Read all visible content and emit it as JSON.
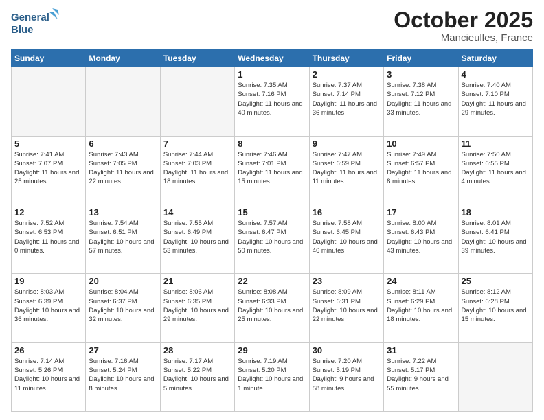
{
  "header": {
    "logo_line1": "General",
    "logo_line2": "Blue",
    "month": "October 2025",
    "location": "Mancieulles, France"
  },
  "weekdays": [
    "Sunday",
    "Monday",
    "Tuesday",
    "Wednesday",
    "Thursday",
    "Friday",
    "Saturday"
  ],
  "weeks": [
    [
      {
        "day": "",
        "info": ""
      },
      {
        "day": "",
        "info": ""
      },
      {
        "day": "",
        "info": ""
      },
      {
        "day": "1",
        "info": "Sunrise: 7:35 AM\nSunset: 7:16 PM\nDaylight: 11 hours\nand 40 minutes."
      },
      {
        "day": "2",
        "info": "Sunrise: 7:37 AM\nSunset: 7:14 PM\nDaylight: 11 hours\nand 36 minutes."
      },
      {
        "day": "3",
        "info": "Sunrise: 7:38 AM\nSunset: 7:12 PM\nDaylight: 11 hours\nand 33 minutes."
      },
      {
        "day": "4",
        "info": "Sunrise: 7:40 AM\nSunset: 7:10 PM\nDaylight: 11 hours\nand 29 minutes."
      }
    ],
    [
      {
        "day": "5",
        "info": "Sunrise: 7:41 AM\nSunset: 7:07 PM\nDaylight: 11 hours\nand 25 minutes."
      },
      {
        "day": "6",
        "info": "Sunrise: 7:43 AM\nSunset: 7:05 PM\nDaylight: 11 hours\nand 22 minutes."
      },
      {
        "day": "7",
        "info": "Sunrise: 7:44 AM\nSunset: 7:03 PM\nDaylight: 11 hours\nand 18 minutes."
      },
      {
        "day": "8",
        "info": "Sunrise: 7:46 AM\nSunset: 7:01 PM\nDaylight: 11 hours\nand 15 minutes."
      },
      {
        "day": "9",
        "info": "Sunrise: 7:47 AM\nSunset: 6:59 PM\nDaylight: 11 hours\nand 11 minutes."
      },
      {
        "day": "10",
        "info": "Sunrise: 7:49 AM\nSunset: 6:57 PM\nDaylight: 11 hours\nand 8 minutes."
      },
      {
        "day": "11",
        "info": "Sunrise: 7:50 AM\nSunset: 6:55 PM\nDaylight: 11 hours\nand 4 minutes."
      }
    ],
    [
      {
        "day": "12",
        "info": "Sunrise: 7:52 AM\nSunset: 6:53 PM\nDaylight: 11 hours\nand 0 minutes."
      },
      {
        "day": "13",
        "info": "Sunrise: 7:54 AM\nSunset: 6:51 PM\nDaylight: 10 hours\nand 57 minutes."
      },
      {
        "day": "14",
        "info": "Sunrise: 7:55 AM\nSunset: 6:49 PM\nDaylight: 10 hours\nand 53 minutes."
      },
      {
        "day": "15",
        "info": "Sunrise: 7:57 AM\nSunset: 6:47 PM\nDaylight: 10 hours\nand 50 minutes."
      },
      {
        "day": "16",
        "info": "Sunrise: 7:58 AM\nSunset: 6:45 PM\nDaylight: 10 hours\nand 46 minutes."
      },
      {
        "day": "17",
        "info": "Sunrise: 8:00 AM\nSunset: 6:43 PM\nDaylight: 10 hours\nand 43 minutes."
      },
      {
        "day": "18",
        "info": "Sunrise: 8:01 AM\nSunset: 6:41 PM\nDaylight: 10 hours\nand 39 minutes."
      }
    ],
    [
      {
        "day": "19",
        "info": "Sunrise: 8:03 AM\nSunset: 6:39 PM\nDaylight: 10 hours\nand 36 minutes."
      },
      {
        "day": "20",
        "info": "Sunrise: 8:04 AM\nSunset: 6:37 PM\nDaylight: 10 hours\nand 32 minutes."
      },
      {
        "day": "21",
        "info": "Sunrise: 8:06 AM\nSunset: 6:35 PM\nDaylight: 10 hours\nand 29 minutes."
      },
      {
        "day": "22",
        "info": "Sunrise: 8:08 AM\nSunset: 6:33 PM\nDaylight: 10 hours\nand 25 minutes."
      },
      {
        "day": "23",
        "info": "Sunrise: 8:09 AM\nSunset: 6:31 PM\nDaylight: 10 hours\nand 22 minutes."
      },
      {
        "day": "24",
        "info": "Sunrise: 8:11 AM\nSunset: 6:29 PM\nDaylight: 10 hours\nand 18 minutes."
      },
      {
        "day": "25",
        "info": "Sunrise: 8:12 AM\nSunset: 6:28 PM\nDaylight: 10 hours\nand 15 minutes."
      }
    ],
    [
      {
        "day": "26",
        "info": "Sunrise: 7:14 AM\nSunset: 5:26 PM\nDaylight: 10 hours\nand 11 minutes."
      },
      {
        "day": "27",
        "info": "Sunrise: 7:16 AM\nSunset: 5:24 PM\nDaylight: 10 hours\nand 8 minutes."
      },
      {
        "day": "28",
        "info": "Sunrise: 7:17 AM\nSunset: 5:22 PM\nDaylight: 10 hours\nand 5 minutes."
      },
      {
        "day": "29",
        "info": "Sunrise: 7:19 AM\nSunset: 5:20 PM\nDaylight: 10 hours\nand 1 minute."
      },
      {
        "day": "30",
        "info": "Sunrise: 7:20 AM\nSunset: 5:19 PM\nDaylight: 9 hours\nand 58 minutes."
      },
      {
        "day": "31",
        "info": "Sunrise: 7:22 AM\nSunset: 5:17 PM\nDaylight: 9 hours\nand 55 minutes."
      },
      {
        "day": "",
        "info": ""
      }
    ]
  ]
}
